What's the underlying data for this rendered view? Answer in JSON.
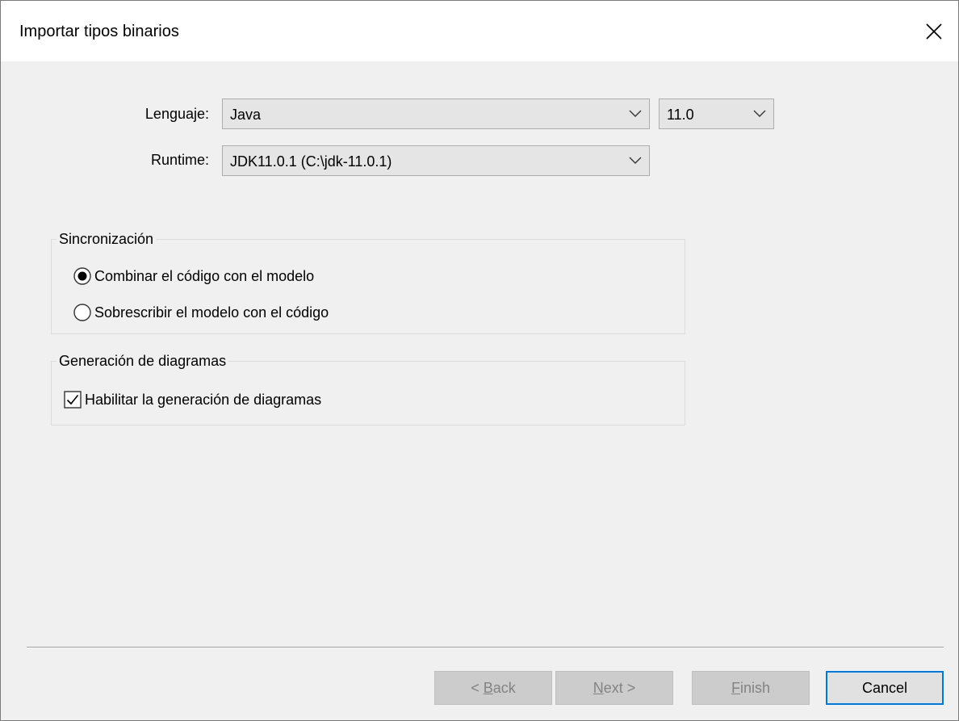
{
  "dialog": {
    "title": "Importar tipos binarios"
  },
  "language": {
    "label": "Lenguaje:",
    "value": "Java",
    "version": "11.0"
  },
  "runtime": {
    "label": "Runtime:",
    "value": "JDK11.0.1 (C:\\jdk-11.0.1)"
  },
  "sync": {
    "title": "Sincronización",
    "options": [
      {
        "label": "Combinar el código con el modelo",
        "selected": true
      },
      {
        "label": "Sobrescribir el modelo con el código",
        "selected": false
      }
    ]
  },
  "diagram": {
    "title": "Generación de diagramas",
    "checkbox_label": "Habilitar la generación de diagramas",
    "checked": true
  },
  "buttons": {
    "back_prefix": "< ",
    "back_mnemonic": "B",
    "back_rest": "ack",
    "next_mnemonic": "N",
    "next_rest": "ext >",
    "finish_mnemonic": "F",
    "finish_rest": "inish",
    "cancel": "Cancel"
  }
}
